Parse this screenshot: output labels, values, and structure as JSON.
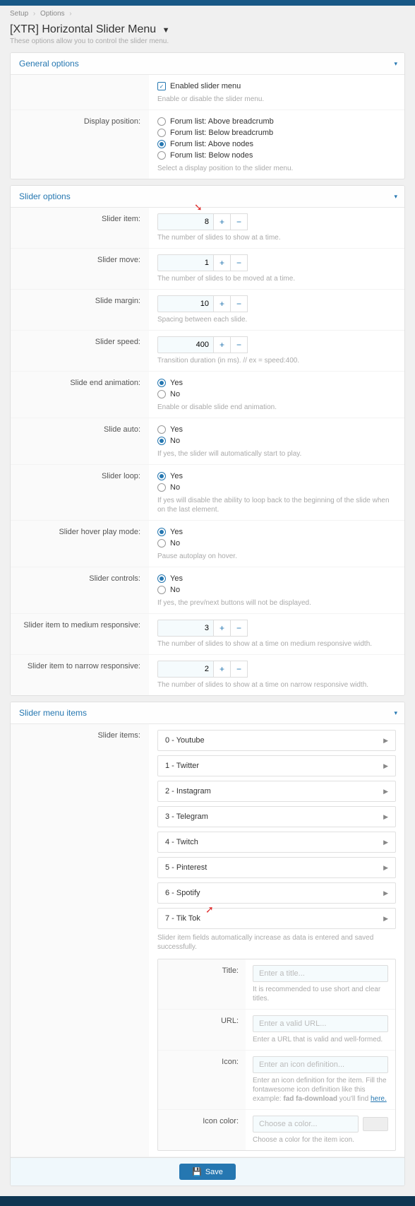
{
  "breadcrumb": {
    "a": "Setup",
    "b": "Options"
  },
  "page_title": "[XTR] Horizontal Slider Menu",
  "subtitle": "These options allow you to control the slider menu.",
  "sections": {
    "general": {
      "title": "General options",
      "enabled": {
        "label": "Enabled slider menu",
        "help": "Enable or disable the slider menu."
      },
      "display_position": {
        "label": "Display position:",
        "opts": [
          "Forum list: Above breadcrumb",
          "Forum list: Below breadcrumb",
          "Forum list: Above nodes",
          "Forum list: Below nodes"
        ],
        "help": "Select a display position to the slider menu."
      }
    },
    "slider": {
      "title": "Slider options",
      "item": {
        "label": "Slider item:",
        "value": "8",
        "help": "The number of slides to show at a time."
      },
      "move": {
        "label": "Slider move:",
        "value": "1",
        "help": "The number of slides to be moved at a time."
      },
      "margin": {
        "label": "Slide margin:",
        "value": "10",
        "help": "Spacing between each slide."
      },
      "speed": {
        "label": "Slider speed:",
        "value": "400",
        "help": "Transition duration (in ms). // ex = speed:400."
      },
      "endanim": {
        "label": "Slide end animation:",
        "help": "Enable or disable slide end animation."
      },
      "auto": {
        "label": "Slide auto:",
        "help": "If yes, the slider will automatically start to play."
      },
      "loop": {
        "label": "Slider loop:",
        "help": "If yes will disable the ability to loop back to the beginning of the slide when on the last element."
      },
      "hover": {
        "label": "Slider hover play mode:",
        "help": "Pause autoplay on hover."
      },
      "controls": {
        "label": "Slider controls:",
        "help": "If yes, the prev/next buttons will not be displayed."
      },
      "medresp": {
        "label": "Slider item to medium responsive:",
        "value": "3",
        "help": "The number of slides to show at a time on medium responsive width."
      },
      "narresp": {
        "label": "Slider item to narrow responsive:",
        "value": "2",
        "help": "The number of slides to show at a time on narrow responsive width."
      },
      "yesno": {
        "y": "Yes",
        "n": "No"
      }
    },
    "menu": {
      "title": "Slider menu items",
      "label": "Slider items:",
      "items": [
        "0 - Youtube",
        "1 - Twitter",
        "2 - Instagram",
        "3 - Telegram",
        "4 - Twitch",
        "5 - Pinterest",
        "6 - Spotify",
        "7 - Tik Tok"
      ],
      "itemshelp": "Slider item fields automatically increase as data is entered and saved successfully.",
      "new": {
        "title": {
          "label": "Title:",
          "ph": "Enter a title...",
          "help": "It is recommended to use short and clear titles."
        },
        "url": {
          "label": "URL:",
          "ph": "Enter a valid URL...",
          "help": "Enter a URL that is valid and well-formed."
        },
        "icon": {
          "label": "Icon:",
          "ph": "Enter an icon definition...",
          "help_a": "Enter an icon definition for the item. Fill the fontawesome icon definition like this example: ",
          "help_b": "fad fa-download",
          "help_c": " you'll find ",
          "help_link": "here."
        },
        "color": {
          "label": "Icon color:",
          "ph": "Choose a color...",
          "help": "Choose a color for the item icon."
        }
      }
    }
  },
  "save": "Save"
}
